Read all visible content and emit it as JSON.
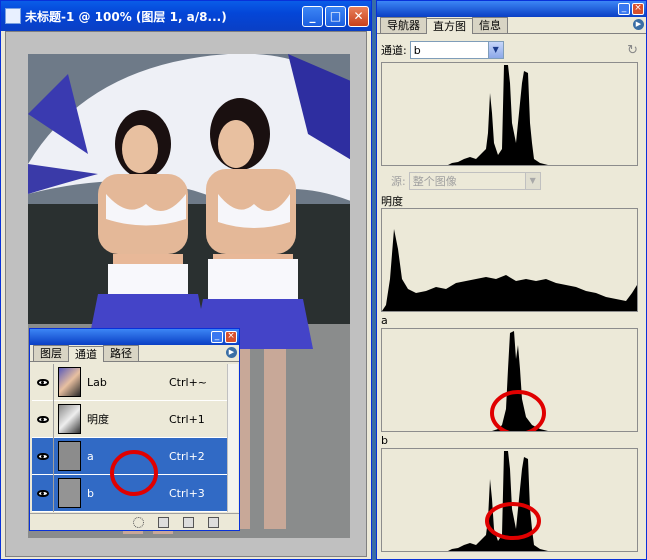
{
  "document": {
    "title": "未标题-1 @ 100% (图层 1, a/8...)",
    "min_glyph": "_",
    "max_glyph": "□",
    "close_glyph": "✕"
  },
  "channels_panel": {
    "tabs": [
      "图层",
      "通道",
      "路径"
    ],
    "active_tab": 1,
    "rows": [
      {
        "name": "Lab",
        "shortcut": "Ctrl+~",
        "selected": false
      },
      {
        "name": "明度",
        "shortcut": "Ctrl+1",
        "selected": false
      },
      {
        "name": "a",
        "shortcut": "Ctrl+2",
        "selected": true
      },
      {
        "name": "b",
        "shortcut": "Ctrl+3",
        "selected": true
      }
    ]
  },
  "histogram_panel": {
    "tabs": [
      "导航器",
      "直方图",
      "信息"
    ],
    "active_tab": 1,
    "channel_label": "通道:",
    "channel_value": "b",
    "source_label": "源:",
    "source_value": "整个图像",
    "sections": [
      "明度",
      "a",
      "b"
    ]
  },
  "colors": {
    "selection": "#316ac5",
    "annotation": "#e00000",
    "panel_bg": "#ece9d8"
  }
}
